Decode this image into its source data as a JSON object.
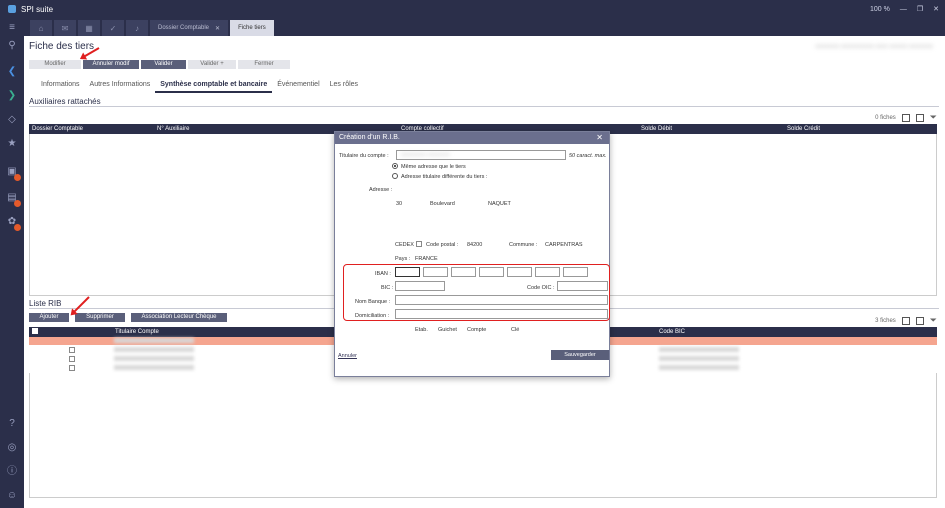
{
  "app": {
    "title": "SPI suite",
    "zoom": "100 %"
  },
  "tabs": [
    {
      "label": "Dossier Comptable",
      "active": false
    },
    {
      "label": "Fiche tiers",
      "active": true
    }
  ],
  "page": {
    "title": "Fiche des tiers",
    "toolbar": {
      "modifier": "Modifier",
      "annuler": "Annuler modif",
      "valider": "Valider",
      "valider_plus": "Valider +",
      "fermer": "Fermer"
    },
    "subtabs": [
      "Informations",
      "Autres Informations",
      "Synthèse comptable et bancaire",
      "Événementiel",
      "Les rôles"
    ],
    "auxiliaires": {
      "title": "Auxiliaires rattachés",
      "count": "0 fiches",
      "columns": [
        "Dossier Comptable",
        "N° Auxiliaire",
        "Compte collectif",
        "Solde Débit",
        "Solde Crédit"
      ]
    },
    "rib": {
      "title": "Liste RIB",
      "buttons": {
        "ajouter": "Ajouter",
        "supprimer": "Supprimer",
        "association": "Association Lecteur Chèque"
      },
      "count": "3 fiches",
      "columns": [
        "Titulaire Compte",
        "Code BIC"
      ]
    }
  },
  "dialog": {
    "title": "Création d'un R.I.B.",
    "titulaire_label": "Titulaire du compte :",
    "max_hint": "50 caract. max.",
    "radio_same": "Même adresse que le tiers",
    "radio_diff": "Adresse titulaire différente du tiers :",
    "adresse_label": "Adresse :",
    "addr_num": "30",
    "addr_type": "Boulevard",
    "addr_name": "NAQUET",
    "cedex_label": "CEDEX :",
    "cp_label": "Code postal :",
    "cp_value": "84200",
    "commune_label": "Commune :",
    "commune_value": "CARPENTRAS",
    "pays_label": "Pays :",
    "pays_value": "FRANCE",
    "iban_label": "IBAN :",
    "bic_label": "BIC :",
    "codeoic_label": "Code OIC :",
    "nombanque_label": "Nom Banque :",
    "domiciliation_label": "Domiciliation :",
    "footer_labels": [
      "Etab.",
      "Guichet",
      "Compte",
      "Clé"
    ],
    "annuler": "Annuler",
    "sauvegarder": "Sauvegarder"
  }
}
